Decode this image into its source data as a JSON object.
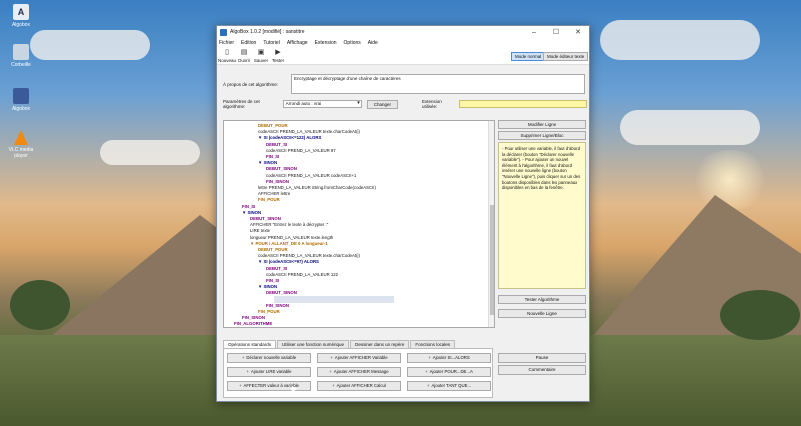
{
  "desktop": {
    "icons": [
      {
        "label": "Algobox",
        "color": "#e8eef6"
      },
      {
        "label": "Corbeille",
        "color": "#c8d6e4"
      },
      {
        "label": "Algobox",
        "color": "#3a5a9a"
      },
      {
        "label": "VLC media player",
        "color": "#f08a10"
      }
    ]
  },
  "window": {
    "title": "AlgoBox 1.0.2 [modifié] : sanstitre",
    "minimize": "–",
    "maximize": "☐",
    "close": "✕"
  },
  "menu": [
    "Fichier",
    "Edition",
    "Tutoriel",
    "Affichage",
    "Extension",
    "Options",
    "Aide"
  ],
  "toolbar": {
    "nouveau": "Nouveau",
    "ouvrir": "Ouvrir",
    "sauver": "Sauver",
    "tester": "Tester",
    "mode_normal": "Mode normal",
    "mode_editeur": "Mode éditeur texte"
  },
  "about": {
    "label": "À propos de cet algorithme:",
    "text": "Encryptage et décryptage d'une chaîne de caractères"
  },
  "params": {
    "label": "Paramètres de cet algorithme:",
    "select": "Arrondi auto : vrai",
    "change": "Changer",
    "ext_label": "Extension utilisée:",
    "ext_value": ""
  },
  "code": [
    {
      "i": 4,
      "t": "DEBUT_POUR",
      "c": "dbg"
    },
    {
      "i": 4,
      "t": "codeASCII PREND_LA_VALEUR texte.charCodeAt(i)",
      "c": "norm"
    },
    {
      "i": 4,
      "t": "▼ SI (codeASCII<=122) ALORS",
      "c": "si"
    },
    {
      "i": 5,
      "t": "DEBUT_SI",
      "c": "fin"
    },
    {
      "i": 5,
      "t": "codeASCII PREND_LA_VALEUR 97",
      "c": "norm"
    },
    {
      "i": 5,
      "t": "FIN_SI",
      "c": "fin"
    },
    {
      "i": 4,
      "t": "▼ SINON",
      "c": "si"
    },
    {
      "i": 5,
      "t": "DEBUT_SINON",
      "c": "fin"
    },
    {
      "i": 5,
      "t": "codeASCII PREND_LA_VALEUR codeASCII+1",
      "c": "norm"
    },
    {
      "i": 5,
      "t": "FIN_SINON",
      "c": "fin"
    },
    {
      "i": 4,
      "t": "lettre PREND_LA_VALEUR String.fromCharCode(codeASCII)",
      "c": "norm"
    },
    {
      "i": 4,
      "t": "AFFICHER lettre",
      "c": "norm"
    },
    {
      "i": 4,
      "t": "FIN_POUR",
      "c": "dbg"
    },
    {
      "i": 2,
      "t": "FIN_SI",
      "c": "fin"
    },
    {
      "i": 2,
      "t": "▼ SINON",
      "c": "si"
    },
    {
      "i": 3,
      "t": "DEBUT_SINON",
      "c": "fin"
    },
    {
      "i": 3,
      "t": "AFFICHER \"Entrez le texte à décrypter :\"",
      "c": "norm"
    },
    {
      "i": 3,
      "t": "LIRE texte",
      "c": "norm"
    },
    {
      "i": 3,
      "t": "longueur PREND_LA_VALEUR texte.length",
      "c": "norm"
    },
    {
      "i": 3,
      "t": "▼ POUR i ALLANT_DE 0 A longueur-1",
      "c": "dbg"
    },
    {
      "i": 4,
      "t": "DEBUT_POUR",
      "c": "dbg"
    },
    {
      "i": 4,
      "t": "codeASCII PREND_LA_VALEUR texte.charCodeAt(i)",
      "c": "norm"
    },
    {
      "i": 4,
      "t": "▼ SI (codeASCII<=97) ALORS",
      "c": "si"
    },
    {
      "i": 5,
      "t": "DEBUT_SI",
      "c": "fin"
    },
    {
      "i": 5,
      "t": "codeASCII PREND_LA_VALEUR 122",
      "c": "norm"
    },
    {
      "i": 5,
      "t": "FIN_SI",
      "c": "fin"
    },
    {
      "i": 4,
      "t": "▼ SINON",
      "c": "si"
    },
    {
      "i": 5,
      "t": "DEBUT_SINON",
      "c": "fin"
    },
    {
      "i": 6,
      "t": "",
      "c": "emp"
    },
    {
      "i": 5,
      "t": "FIN_SINON",
      "c": "fin"
    },
    {
      "i": 4,
      "t": "FIN_POUR",
      "c": "dbg"
    },
    {
      "i": 2,
      "t": "FIN_SINON",
      "c": "fin"
    },
    {
      "i": 1,
      "t": "FIN_ALGORITHME",
      "c": "fin"
    }
  ],
  "side": {
    "modifier": "Modifier Ligne",
    "supprimer": "Supprimer Ligne/Bloc",
    "help": "- Pour utiliser une variable, il faut d'abord la déclarer (bouton \"Déclarer nouvelle variable\").\n- Pour ajouter un nouvel élément à l'algorithme, il faut d'abord insérer une nouvelle ligne (bouton \"Nouvelle Ligne\"), puis cliquer sur un des boutons disponibles dans les panneaux disponibles en bas de la fenêtre.",
    "tester": "Tester Algorithme",
    "nouvelle": "Nouvelle Ligne"
  },
  "tabs": [
    "Opérations standards",
    "Utiliser une fonction numérique",
    "Dessiner dans un repère",
    "Fonctions locales"
  ],
  "ops": [
    "Déclarer nouvelle variable",
    "Ajouter AFFICHER Variable",
    "Ajouter SI...ALORS",
    "Ajouter LIRE variable",
    "Ajouter AFFICHER Message",
    "Ajouter POUR...DE...A",
    "AFFECTER valeur à variable",
    "Ajouter AFFICHER Calcul",
    "Ajouter TANT QUE..."
  ],
  "right_buttons": {
    "pause": "Pause",
    "commentaire": "Commentaire"
  }
}
